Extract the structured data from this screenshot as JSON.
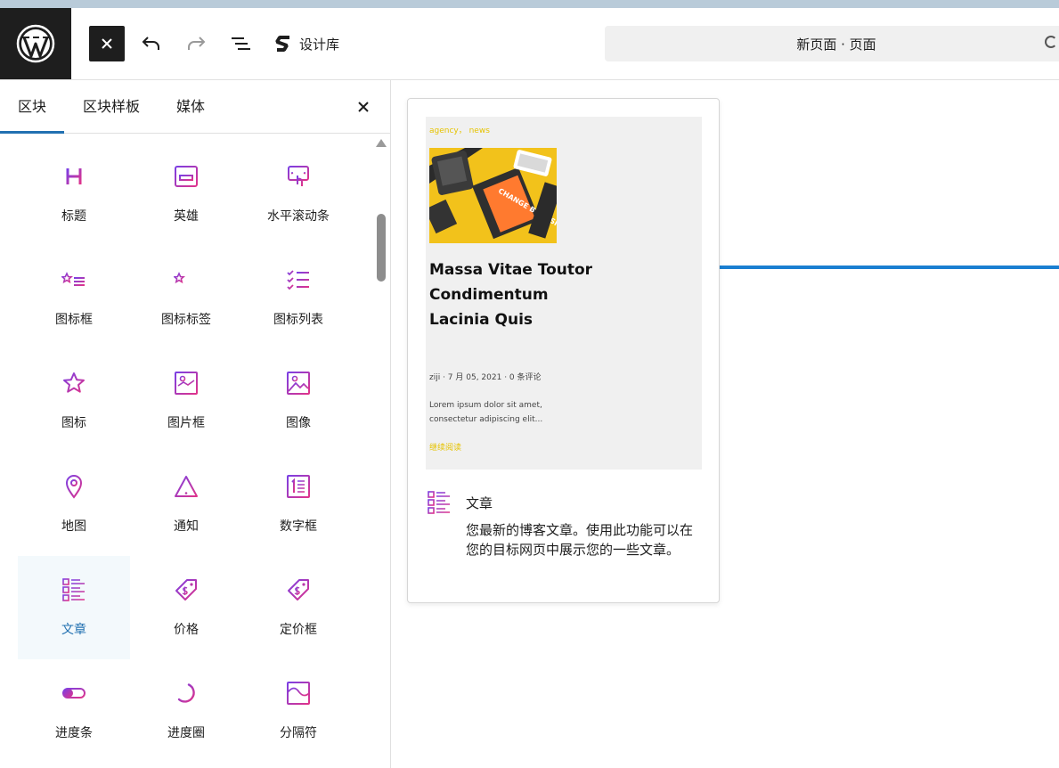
{
  "toolbar": {
    "library_label": "设计库",
    "doc_title": "新页面 · 页面"
  },
  "sidebar": {
    "tabs": [
      {
        "label": "区块"
      },
      {
        "label": "区块样板"
      },
      {
        "label": "媒体"
      }
    ],
    "blocks": [
      {
        "label": "标题",
        "icon": "heading-icon"
      },
      {
        "label": "英雄",
        "icon": "hero-icon"
      },
      {
        "label": "水平滚动条",
        "icon": "horizontal-scroller-icon"
      },
      {
        "label": "图标框",
        "icon": "icon-box-icon"
      },
      {
        "label": "图标标签",
        "icon": "icon-label-icon"
      },
      {
        "label": "图标列表",
        "icon": "icon-list-icon"
      },
      {
        "label": "图标",
        "icon": "star-icon"
      },
      {
        "label": "图片框",
        "icon": "image-box-icon"
      },
      {
        "label": "图像",
        "icon": "image-icon"
      },
      {
        "label": "地图",
        "icon": "map-pin-icon"
      },
      {
        "label": "通知",
        "icon": "warning-icon"
      },
      {
        "label": "数字框",
        "icon": "number-box-icon"
      },
      {
        "label": "文章",
        "icon": "posts-icon",
        "active": true
      },
      {
        "label": "价格",
        "icon": "price-tag-icon"
      },
      {
        "label": "定价框",
        "icon": "pricing-box-icon"
      },
      {
        "label": "进度条",
        "icon": "progress-bar-icon"
      },
      {
        "label": "进度圈",
        "icon": "progress-circle-icon"
      },
      {
        "label": "分隔符",
        "icon": "divider-icon"
      }
    ]
  },
  "preview": {
    "categories": "agency，  news",
    "post_title": "Massa Vitae Toutor Condimentum Lacinia Quis",
    "meta": "ziji  ·  7 月 05, 2021  ·  0 条评论",
    "excerpt": "Lorem ipsum dolor sit amet, consectetur adipiscing elit...",
    "read_more": "继续阅读",
    "thumb_text": "CHANGE BY DESIGN",
    "info_title": "文章",
    "info_description": "您最新的博客文章。使用此功能可以在您的目标网页中展示您的一些文章。"
  },
  "colors": {
    "accent": "#2271b1",
    "icon_gradient_start": "#7b3fe4",
    "icon_gradient_end": "#e0338a",
    "highlight_yellow": "#e6c300",
    "insert_line": "#1a7fd1"
  }
}
